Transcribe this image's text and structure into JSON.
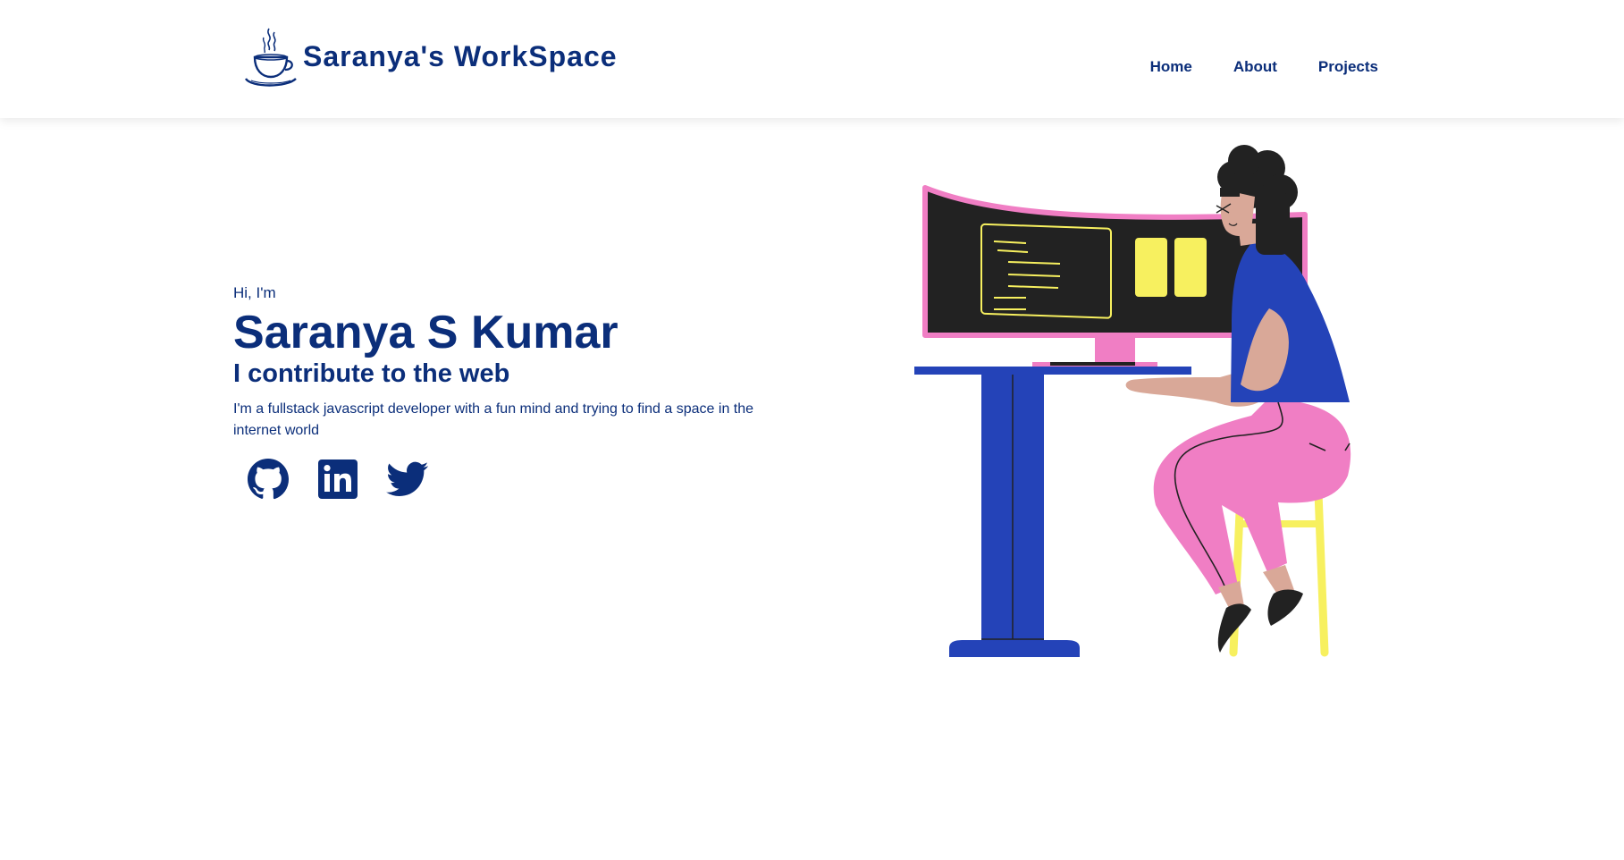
{
  "header": {
    "brand_title": "Saranya's WorkSpace",
    "logo_icon": "coffee-cup-icon",
    "nav": [
      {
        "label": "Home"
      },
      {
        "label": "About"
      },
      {
        "label": "Projects"
      }
    ]
  },
  "hero": {
    "greeting": "Hi, I'm",
    "name": "Saranya S Kumar",
    "tagline": "I contribute to the web",
    "description": "I'm a fullstack javascript developer with a fun mind and trying to find a space in the internet world",
    "socials": [
      {
        "icon": "github-icon"
      },
      {
        "icon": "linkedin-icon"
      },
      {
        "icon": "twitter-icon"
      }
    ]
  },
  "colors": {
    "primary": "#0b2e7a",
    "blue": "#2443b8",
    "pink": "#f07ec4",
    "yellow": "#f7f05f",
    "dark": "#222222",
    "skin": "#d9a898"
  }
}
